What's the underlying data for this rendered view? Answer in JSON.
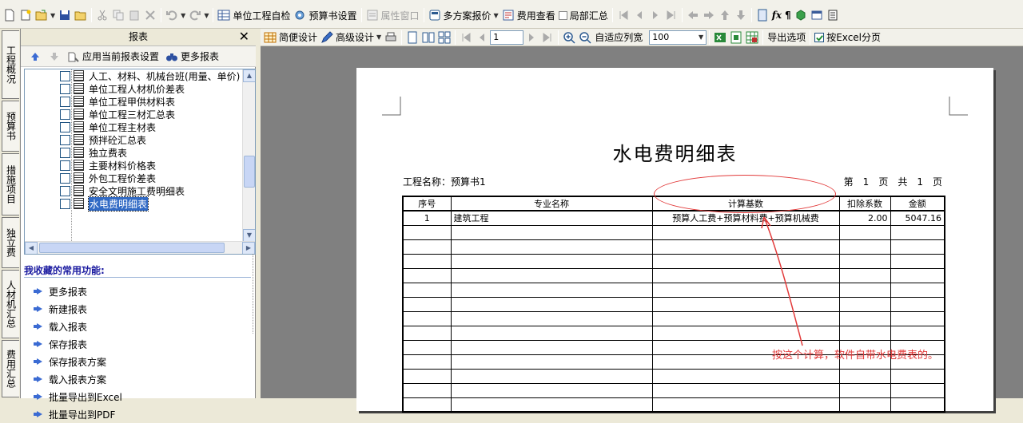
{
  "toolbar1": {
    "unit_check": "单位工程自检",
    "budget_setting": "预算书设置",
    "property_window": "属性窗口",
    "multi_quote": "多方案报价",
    "fee_view": "费用查看",
    "partial_summary": "局部汇总"
  },
  "vtabs": [
    "工程概况",
    "预算书",
    "措施项目",
    "独立费",
    "人材机汇总",
    "费用汇总"
  ],
  "panel": {
    "title": "报表",
    "close": "✕",
    "apply_setting": "应用当前报表设置",
    "more_reports": "更多报表"
  },
  "tree": [
    "人工、材料、机械台班(用量、单价)",
    "单位工程人材机价差表",
    "单位工程甲供材料表",
    "单位工程三材汇总表",
    "单位工程主材表",
    "预拌砼汇总表",
    "独立费表",
    "主要材料价格表",
    "外包工程价差表",
    "安全文明施工费明细表",
    "水电费明细表"
  ],
  "favorites": {
    "title": "我收藏的常用功能:",
    "items": [
      "更多报表",
      "新建报表",
      "载入报表",
      "保存报表",
      "保存报表方案",
      "载入报表方案",
      "批量导出到Excel",
      "批量导出到PDF"
    ]
  },
  "toolbar2": {
    "simple_design": "简便设计",
    "advanced_design": "高级设计",
    "page_number": "1",
    "fit_width": "自适应列宽",
    "zoom": "100",
    "export_options": "导出选项",
    "excel_paging": "按Excel分页"
  },
  "report": {
    "title": "水电费明细表",
    "project_label": "工程名称：预算书1",
    "page_di": "第",
    "page_cur": "1",
    "page_ye": "页",
    "page_gong": "共",
    "page_total": "1",
    "page_ye2": "页",
    "headers": [
      "序号",
      "专业名称",
      "计算基数",
      "扣除系数",
      "金额"
    ],
    "row": [
      "1",
      "建筑工程",
      "预算人工费+预算材料费+预算机械费",
      "2.00",
      "5047.16"
    ]
  },
  "annotation": {
    "text": "按这个计算，软件自带水电费表的。",
    "color": "#e23a3a"
  }
}
